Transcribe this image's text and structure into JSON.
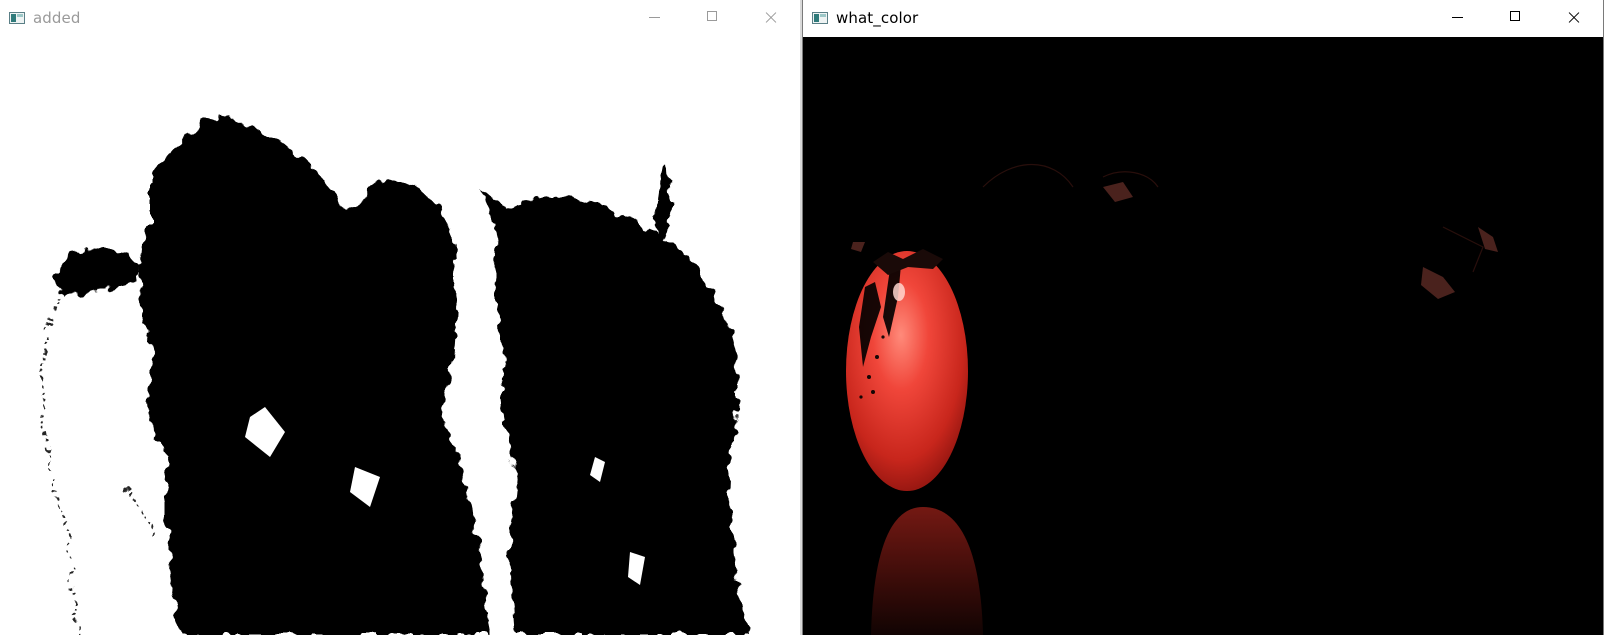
{
  "windows": {
    "left": {
      "title": "added",
      "state": "inactive"
    },
    "right": {
      "title": "what_color",
      "state": "active"
    }
  },
  "controls": {
    "minimize": "minimize-icon",
    "maximize": "maximize-icon",
    "close": "close-icon"
  },
  "colors": {
    "mask_foreground": "#000000",
    "mask_background": "#ffffff",
    "tomato_red": "#e0362b",
    "canvas_black": "#000000"
  }
}
